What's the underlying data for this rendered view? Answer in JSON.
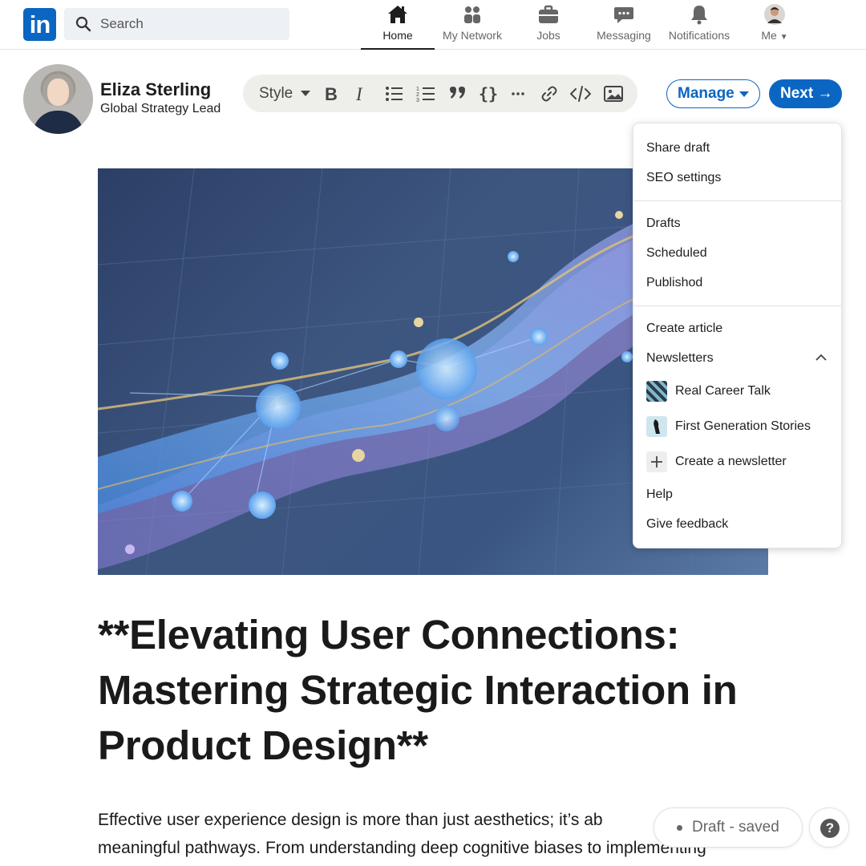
{
  "nav": {
    "logo_text": "in",
    "search_placeholder": "Search",
    "items": [
      {
        "label": "Home",
        "icon": "home-icon",
        "active": true
      },
      {
        "label": "My Network",
        "icon": "network-icon"
      },
      {
        "label": "Jobs",
        "icon": "briefcase-icon"
      },
      {
        "label": "Messaging",
        "icon": "chat-icon"
      },
      {
        "label": "Notifications",
        "icon": "bell-icon"
      },
      {
        "label": "Me",
        "icon": "profile-avatar"
      }
    ],
    "active_color": "#1d1d1d",
    "brand_color": "#0a66c2"
  },
  "author": {
    "name": "Eliza Sterling",
    "title": "Global Strategy Lead"
  },
  "toolbar": {
    "style_label": "Style",
    "tools": [
      "bold-icon",
      "italic-icon",
      "bullet-list-icon",
      "numbered-list-icon",
      "quote-icon",
      "code-braces-icon",
      "more-icon",
      "link-icon",
      "code-embed-icon",
      "image-icon"
    ]
  },
  "actions": {
    "manage_label": "Manage",
    "next_label": "Next →"
  },
  "menu": {
    "share_draft": "Share draft",
    "seo_settings": "SEO settings",
    "drafts": "Drafts",
    "scheduled": "Scheduled",
    "published": "Publishod",
    "create_article": "Create article",
    "newsletters": "Newsletters",
    "newsletter_items": [
      "Real Career Talk",
      "First Generation Stories"
    ],
    "create_newsletter": "Create a newsletter",
    "help": "Help",
    "give_feedback": "Give feedback"
  },
  "article": {
    "headline_lines": [
      "**Elevating User Connections:",
      "Mastering Strategic Interaction in",
      "Product Design**"
    ],
    "body_lines": [
      "Effective user experience design is more than just aesthetics; it’s ab",
      "meaningful pathways. From understanding deep cognitive biases to implementing"
    ]
  },
  "status": {
    "draft_label": "Draft - saved",
    "help_label": "?"
  }
}
